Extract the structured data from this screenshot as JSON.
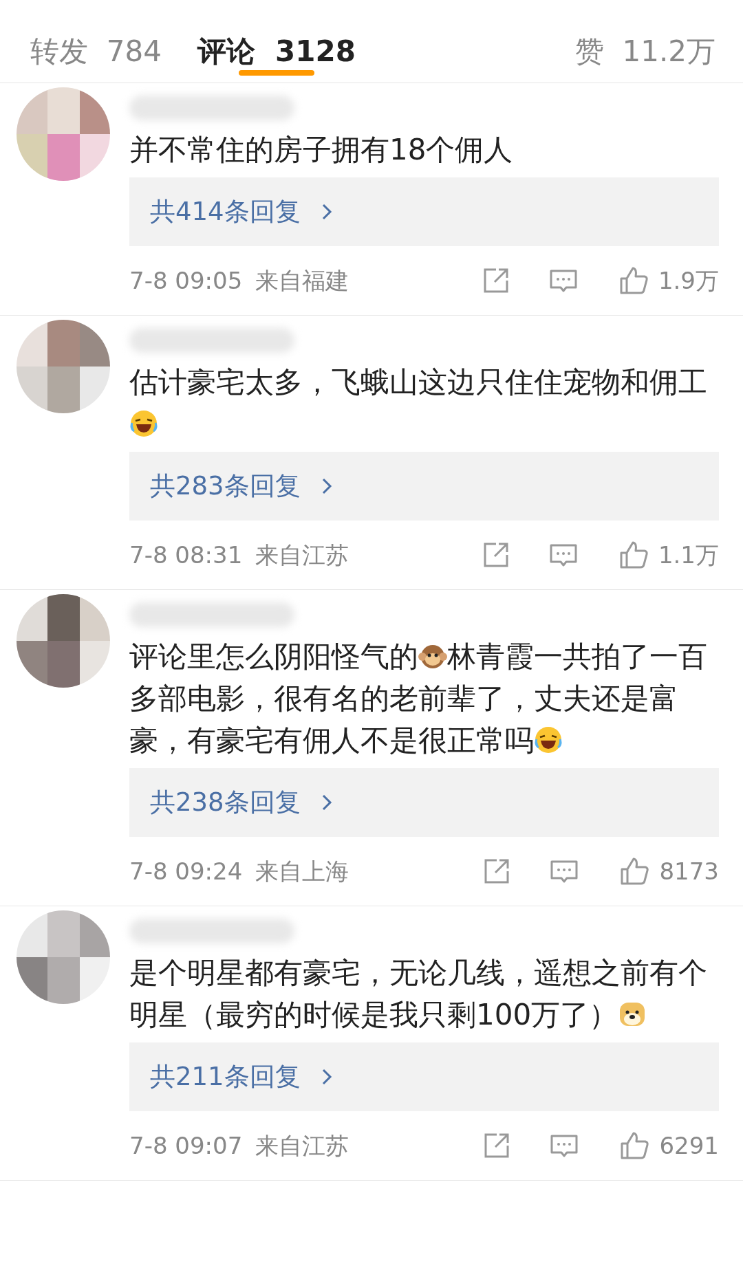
{
  "tabs": [
    {
      "label": "转发",
      "count": "784",
      "selected": false
    },
    {
      "label": "评论",
      "count": "3128",
      "selected": true
    },
    {
      "label": "赞",
      "count": "11.2万",
      "selected": false
    }
  ],
  "comments": [
    {
      "text": [
        {
          "kind": "text",
          "text": "并不常住的房子拥有18个佣人"
        }
      ],
      "replies": "共414条回复",
      "time": "7-8 09:05",
      "location": "来自福建",
      "likes": "1.9万"
    },
    {
      "text": [
        {
          "kind": "text",
          "text": "估计豪宅太多，飞蛾山这边只住住宠物和佣工"
        },
        {
          "kind": "laugh"
        }
      ],
      "replies": "共283条回复",
      "time": "7-8 08:31",
      "location": "来自江苏",
      "likes": "1.1万"
    },
    {
      "text": [
        {
          "kind": "text",
          "text": "评论里怎么阴阳怪气的"
        },
        {
          "kind": "monkey"
        },
        {
          "kind": "text",
          "text": "林青霞一共拍了一百多部电影，很有名的老前辈了，丈夫还是富豪，有豪宅有佣人不是很正常吗"
        },
        {
          "kind": "laugh"
        }
      ],
      "replies": "共238条回复",
      "time": "7-8 09:24",
      "location": "来自上海",
      "likes": "8173"
    },
    {
      "text": [
        {
          "kind": "text",
          "text": "是个明星都有豪宅，无论几线，遥想之前有个明星（最穷的时候是我只剩100万了）"
        },
        {
          "kind": "doge"
        }
      ],
      "replies": "共211条回复",
      "time": "7-8 09:07",
      "location": "来自江苏",
      "likes": "6291"
    }
  ]
}
